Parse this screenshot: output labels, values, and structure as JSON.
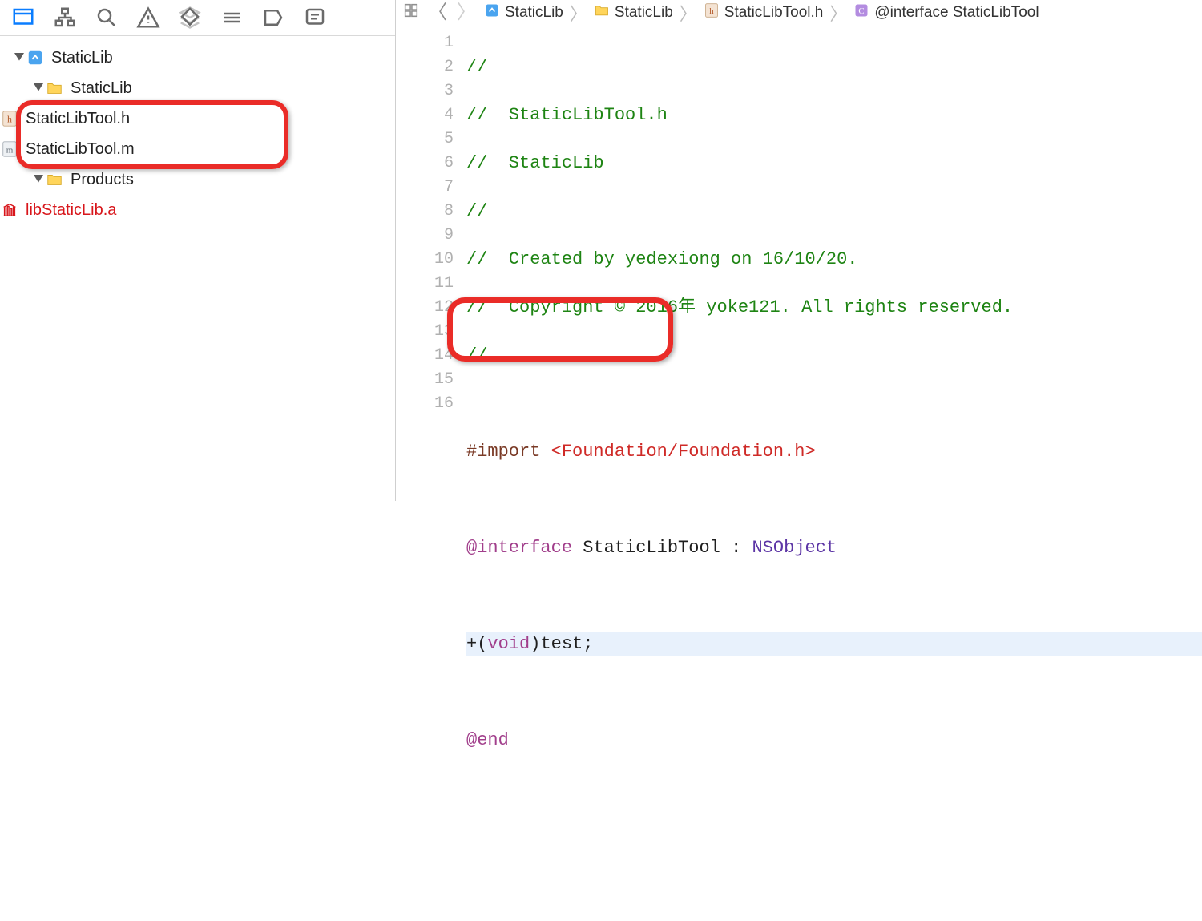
{
  "navigator": {
    "tabs": [
      "project",
      "hierarchy",
      "search",
      "issues",
      "tests",
      "debug",
      "breakpoints",
      "tags",
      "logs"
    ],
    "active_index": 0
  },
  "tree": {
    "project": "StaticLib",
    "folders": [
      {
        "name": "StaticLib",
        "files": [
          {
            "name": "StaticLibTool.h",
            "kind": "h"
          },
          {
            "name": "StaticLibTool.m",
            "kind": "m"
          }
        ]
      },
      {
        "name": "Products",
        "files": [
          {
            "name": "libStaticLib.a",
            "kind": "lib",
            "red": true
          }
        ]
      }
    ]
  },
  "breadcrumb": {
    "project": "StaticLib",
    "folder": "StaticLib",
    "file": "StaticLibTool.h",
    "symbol": "@interface StaticLibTool"
  },
  "code": {
    "line_count": 16,
    "lines": {
      "1": "//",
      "2": "//  StaticLibTool.h",
      "3": "//  StaticLib",
      "4": "//",
      "5": "//  Created by yedexiong on 16/10/20.",
      "6": "//  Copyright © 2016年 yoke121. All rights reserved.",
      "7": "//",
      "8": "",
      "9_pre": "#import ",
      "9_arg": "<Foundation/Foundation.h>",
      "10": "",
      "11_kw": "@interface",
      "11_name": " StaticLibTool : ",
      "11_cls": "NSObject",
      "12": "",
      "13_plus": "+(",
      "13_void": "void",
      "13_rest": ")test;",
      "14": "",
      "15": "@end",
      "16": ""
    },
    "selected_line": 13
  }
}
